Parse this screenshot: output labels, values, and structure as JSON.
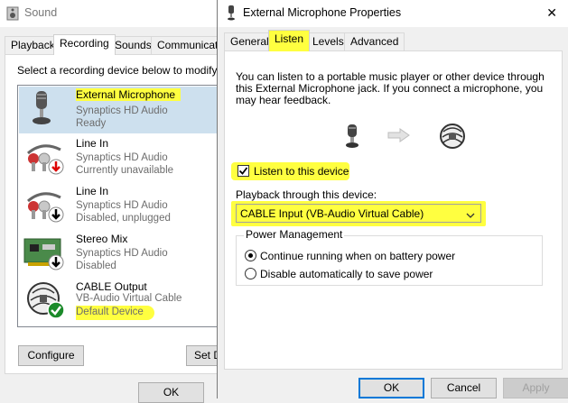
{
  "sound_window": {
    "title": "Sound",
    "tabs": [
      "Playback",
      "Recording",
      "Sounds",
      "Communication"
    ],
    "active_tab": "Recording",
    "instruction": "Select a recording device below to modify i",
    "devices": [
      {
        "name": "External Microphone",
        "driver": "Synaptics HD Audio",
        "status": "Ready",
        "icon": "microphone-icon",
        "badge": ""
      },
      {
        "name": "Line In",
        "driver": "Synaptics HD Audio",
        "status": "Currently unavailable",
        "icon": "line-in-jack-icon",
        "badge": "red-down-arrow"
      },
      {
        "name": "Line In",
        "driver": "Synaptics HD Audio",
        "status": "Disabled, unplugged",
        "icon": "line-in-jack-icon",
        "badge": "black-down-arrow"
      },
      {
        "name": "Stereo Mix",
        "driver": "Synaptics HD Audio",
        "status": "Disabled",
        "icon": "sound-card-icon",
        "badge": "black-down-arrow"
      },
      {
        "name": "CABLE Output",
        "driver": "VB-Audio Virtual Cable",
        "status": "Default Device",
        "icon": "virtual-cable-icon",
        "badge": "green-check"
      }
    ],
    "configure_label": "Configure",
    "set_default_label": "Set D",
    "ok_label": "OK"
  },
  "props_window": {
    "title": "External Microphone Properties",
    "close_glyph": "✕",
    "tabs": [
      "General",
      "Listen",
      "Levels",
      "Advanced"
    ],
    "active_tab": "Listen",
    "description": "You can listen to a portable music player or other device through this External Microphone jack.  If you connect a microphone, you may hear feedback.",
    "listen_checkbox_label": "Listen to this device",
    "listen_checked": true,
    "playback_label": "Playback through this device:",
    "playback_value": "CABLE Input (VB-Audio Virtual Cable)",
    "power_group_label": "Power Management",
    "power_options": [
      "Continue running when on battery power",
      "Disable automatically to save power"
    ],
    "power_selected": 0,
    "buttons": {
      "ok": "OK",
      "cancel": "Cancel",
      "apply": "Apply"
    }
  },
  "colors": {
    "highlight": "#ffff40",
    "accent": "#0078d7",
    "gray_text": "#6d6d6d"
  }
}
